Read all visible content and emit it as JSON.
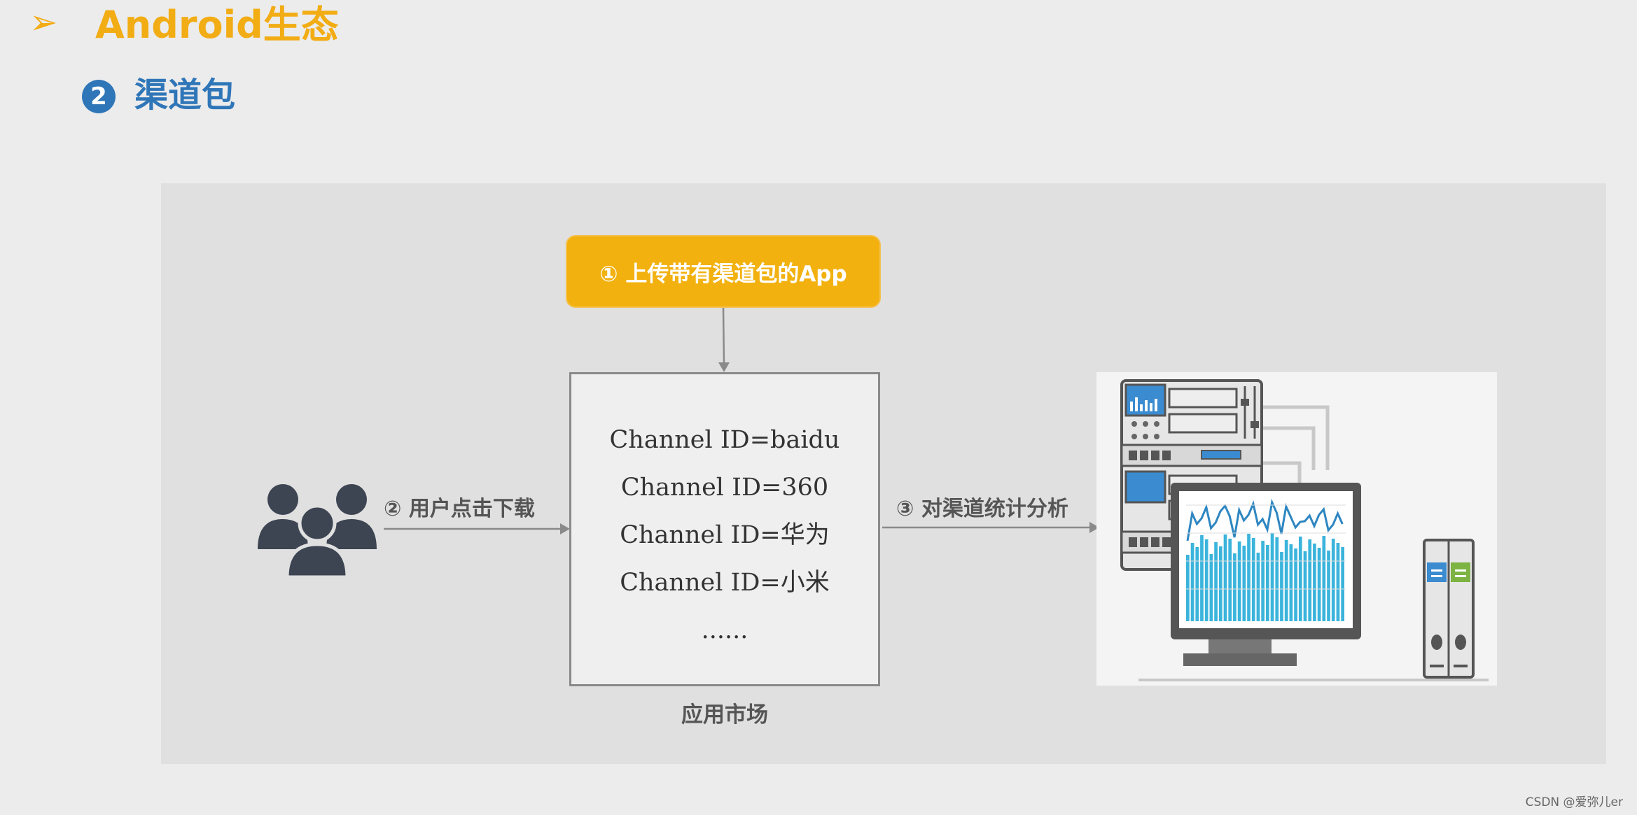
{
  "heading": {
    "arrow": "➢",
    "title": "Android生态"
  },
  "subheading": {
    "number": "2",
    "title": "渠道包"
  },
  "diagram": {
    "upload_box": "① 上传带有渠道包的App",
    "market": {
      "channels": [
        "Channel ID=baidu",
        "Channel ID=360",
        "Channel ID=华为",
        "Channel ID=小米",
        "......"
      ],
      "label": "应用市场"
    },
    "step_download": "② 用户点击下载",
    "step_analysis": "③ 对渠道统计分析"
  },
  "watermark": "CSDN @爱弥儿er",
  "colors": {
    "heading": "#f2ac14",
    "subheading": "#2f76b8",
    "upload_box": "#f2b10f",
    "panel": "#e0e0e0",
    "users_icon": "#3d4452",
    "chart_bar": "#3bb4dc"
  },
  "icons": [
    "users-icon",
    "server-rack-icon",
    "monitor-chart-icon",
    "storage-tower-icon"
  ]
}
